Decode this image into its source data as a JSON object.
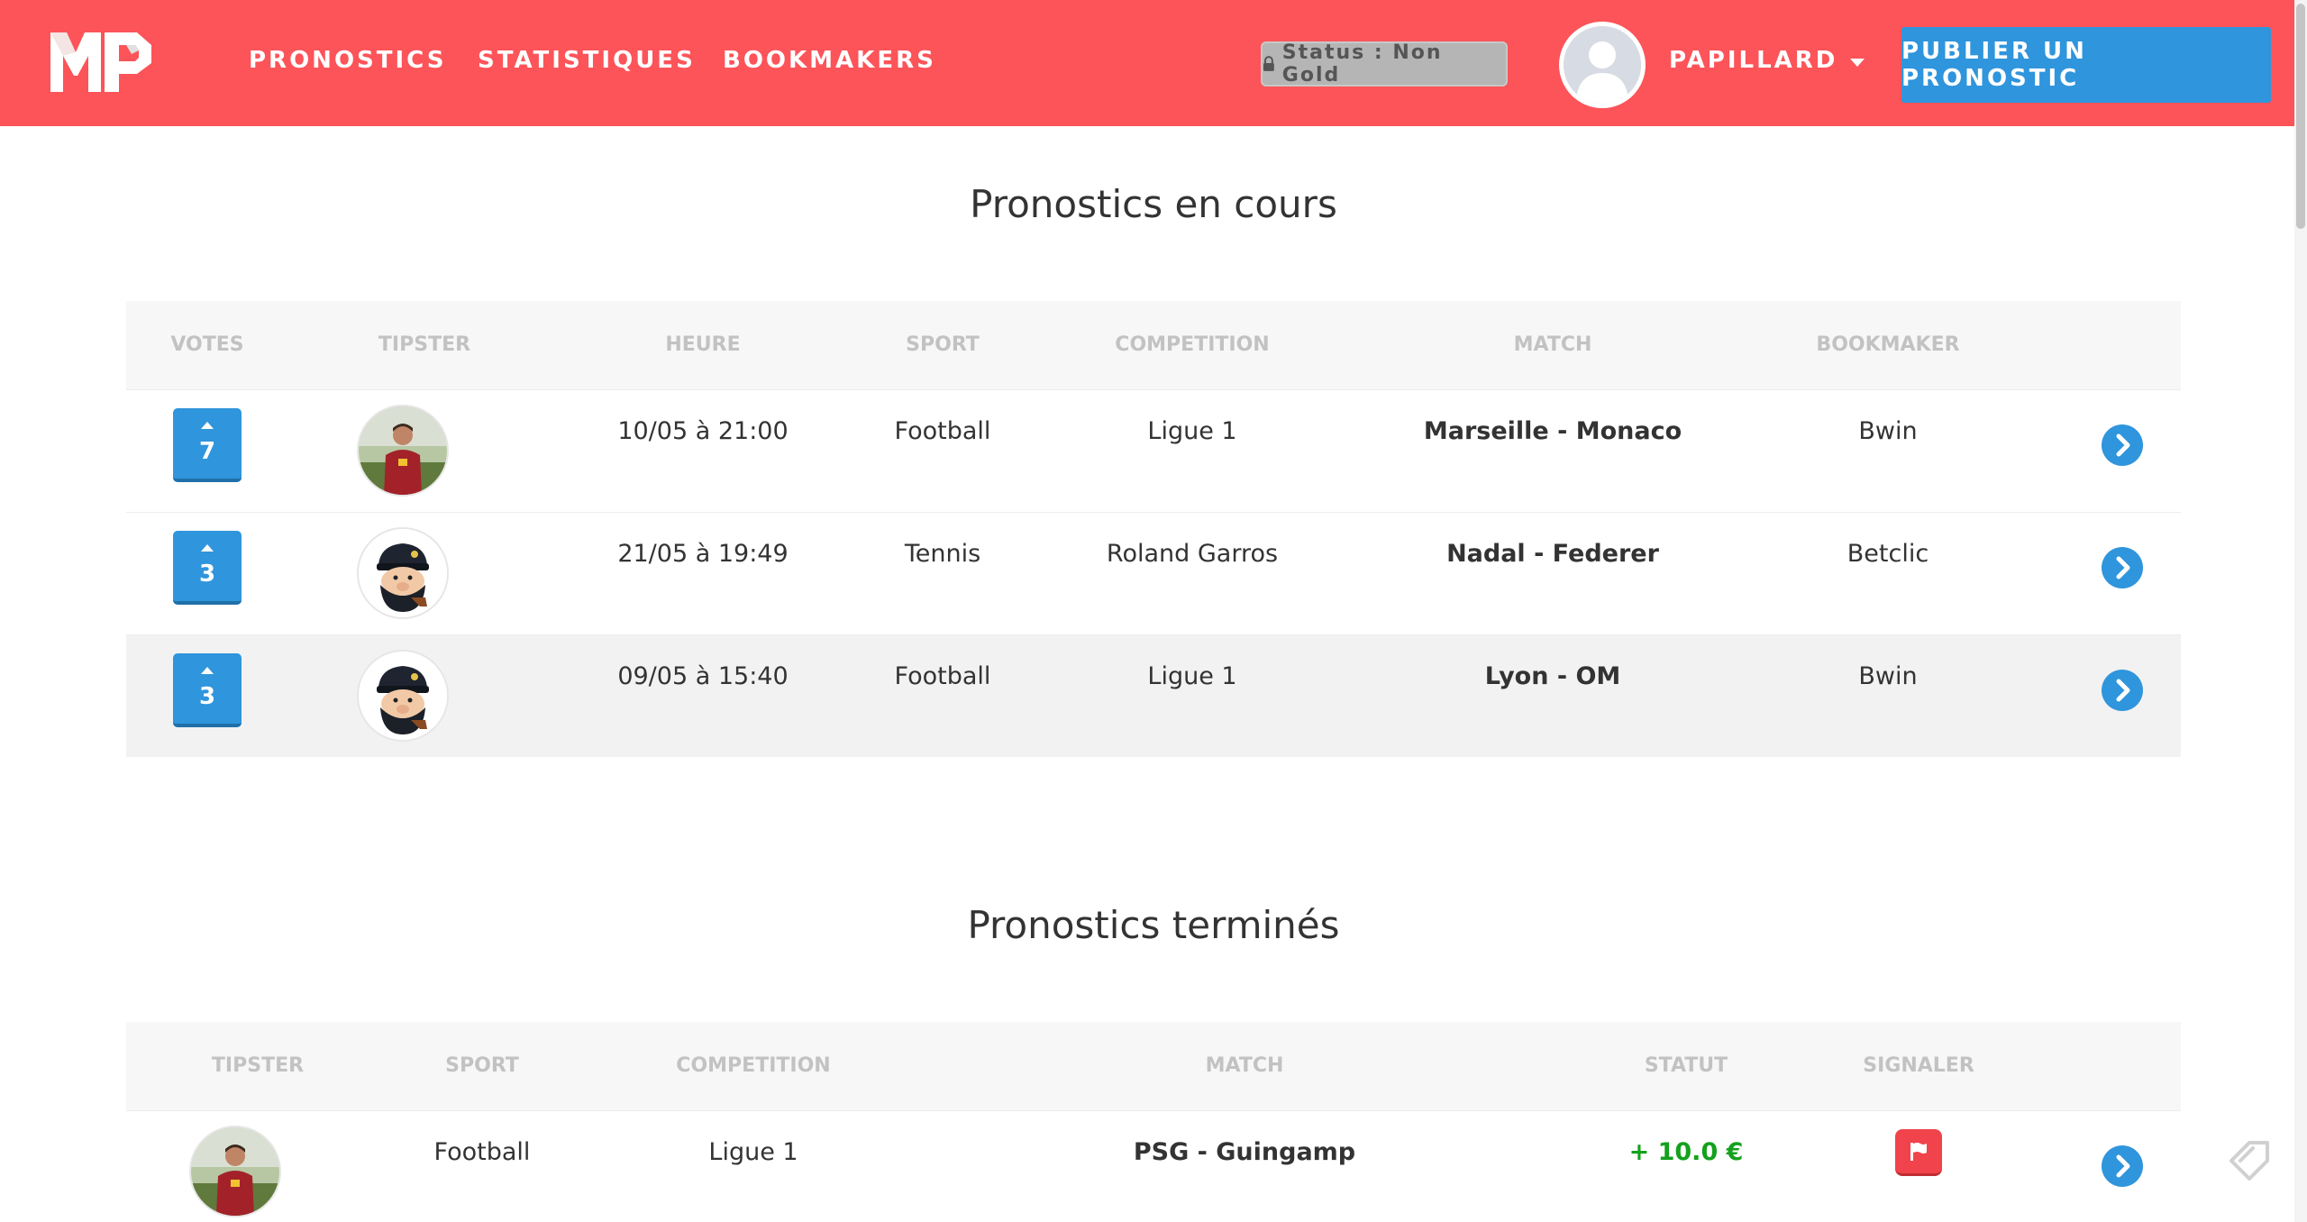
{
  "header": {
    "logo_text": "MP",
    "nav": [
      {
        "label": "PRONOSTICS"
      },
      {
        "label": "STATISTIQUES"
      },
      {
        "label": "BOOKMAKERS"
      }
    ],
    "status_label": "Status : Non Gold",
    "username": "PAPILLARD",
    "publish_label": "PUBLIER UN PRONOSTIC"
  },
  "ongoing": {
    "title": "Pronostics en cours",
    "columns": [
      "VOTES",
      "TIPSTER",
      "HEURE",
      "SPORT",
      "COMPETITION",
      "MATCH",
      "BOOKMAKER"
    ],
    "rows": [
      {
        "votes": "7",
        "tipster": "roma-player",
        "time": "10/05 à 21:00",
        "sport": "Football",
        "competition": "Ligue 1",
        "match": "Marseille - Monaco",
        "bookmaker": "Bwin"
      },
      {
        "votes": "3",
        "tipster": "captain",
        "time": "21/05 à 19:49",
        "sport": "Tennis",
        "competition": "Roland Garros",
        "match": "Nadal - Federer",
        "bookmaker": "Betclic"
      },
      {
        "votes": "3",
        "tipster": "captain",
        "time": "09/05 à 15:40",
        "sport": "Football",
        "competition": "Ligue 1",
        "match": "Lyon - OM",
        "bookmaker": "Bwin"
      }
    ]
  },
  "finished": {
    "title": "Pronostics terminés",
    "columns": [
      "TIPSTER",
      "SPORT",
      "COMPETITION",
      "MATCH",
      "STATUT",
      "SIGNALER"
    ],
    "rows": [
      {
        "tipster": "roma-player",
        "sport": "Football",
        "competition": "Ligue 1",
        "match": "PSG - Guingamp",
        "status": "+ 10.0 €"
      }
    ]
  },
  "colors": {
    "navbar": "#fc5459",
    "accent_blue": "#2f95dc",
    "positive": "#14a11d",
    "flag_red": "#f1434b"
  },
  "icons": {
    "lock": "lock-icon",
    "caret": "chevron-down-icon",
    "row_action": "chevron-right-circle-icon",
    "report": "flag-icon",
    "vote": "arrow-up-icon"
  }
}
